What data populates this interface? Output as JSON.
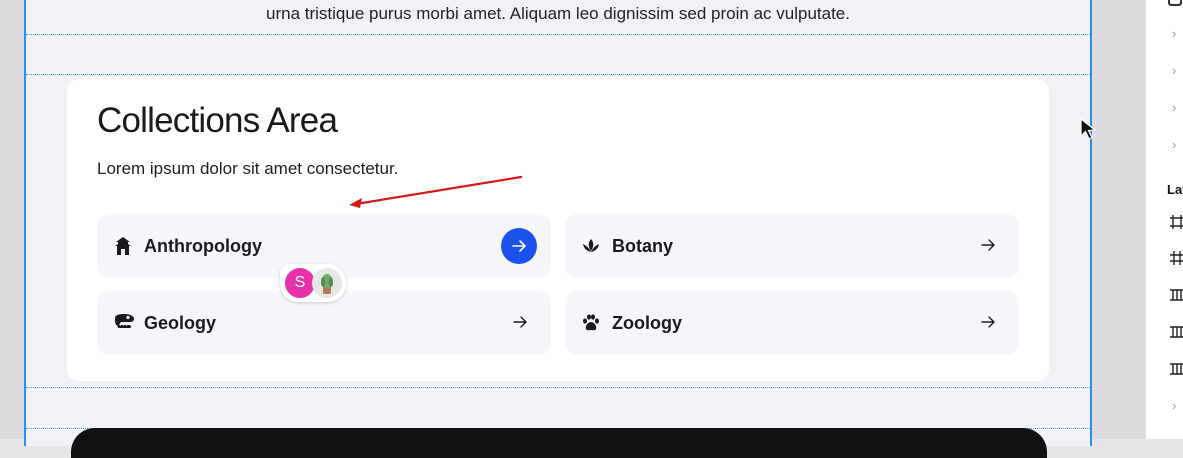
{
  "intro": {
    "text": "urna tristique purus morbi amet. Aliquam leo dignissim sed proin ac vulputate."
  },
  "collections": {
    "title": "Collections Area",
    "subtitle": "Lorem ipsum dolor sit amet consectetur.",
    "items": [
      {
        "label": "Anthropology",
        "icon": "pagoda-icon",
        "active": true
      },
      {
        "label": "Botany",
        "icon": "leaf-icon",
        "active": false
      },
      {
        "label": "Geology",
        "icon": "dinosaur-skull-icon",
        "active": false
      },
      {
        "label": "Zoology",
        "icon": "paw-icon",
        "active": false
      }
    ]
  },
  "collaborators": {
    "initial": "S",
    "colors": {
      "avatar_s": "#e631a8"
    }
  },
  "right_panel": {
    "layers_label": "Lay"
  },
  "colors": {
    "accent": "#1a52ea",
    "guide": "#2b8ff0",
    "annotation_arrow": "#d11a1a",
    "tile_bg": "#f6f7fb"
  }
}
